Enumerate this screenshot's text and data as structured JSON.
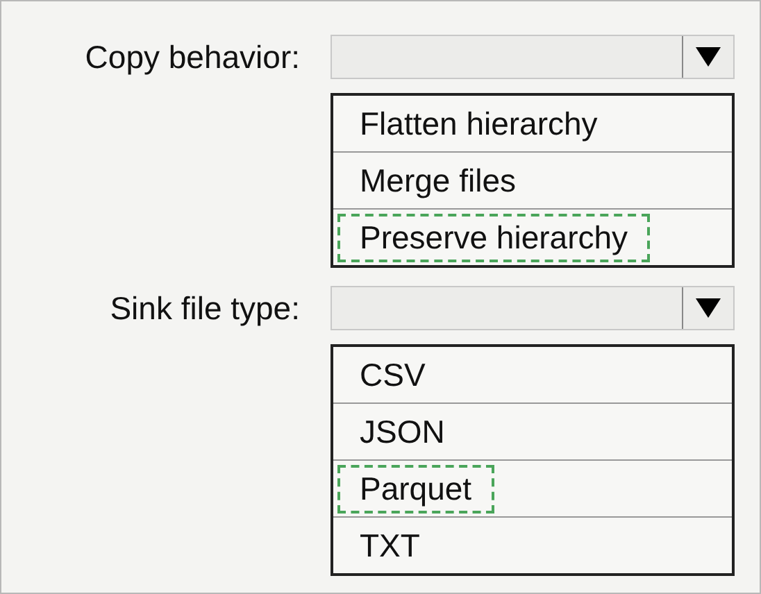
{
  "fields": [
    {
      "label": "Copy behavior:",
      "options": [
        {
          "label": "Flatten hierarchy",
          "selected": false
        },
        {
          "label": "Merge files",
          "selected": false
        },
        {
          "label": "Preserve hierarchy",
          "selected": true
        }
      ]
    },
    {
      "label": "Sink file type:",
      "options": [
        {
          "label": "CSV",
          "selected": false
        },
        {
          "label": "JSON",
          "selected": false
        },
        {
          "label": "Parquet",
          "selected": true
        },
        {
          "label": "TXT",
          "selected": false
        }
      ]
    }
  ]
}
